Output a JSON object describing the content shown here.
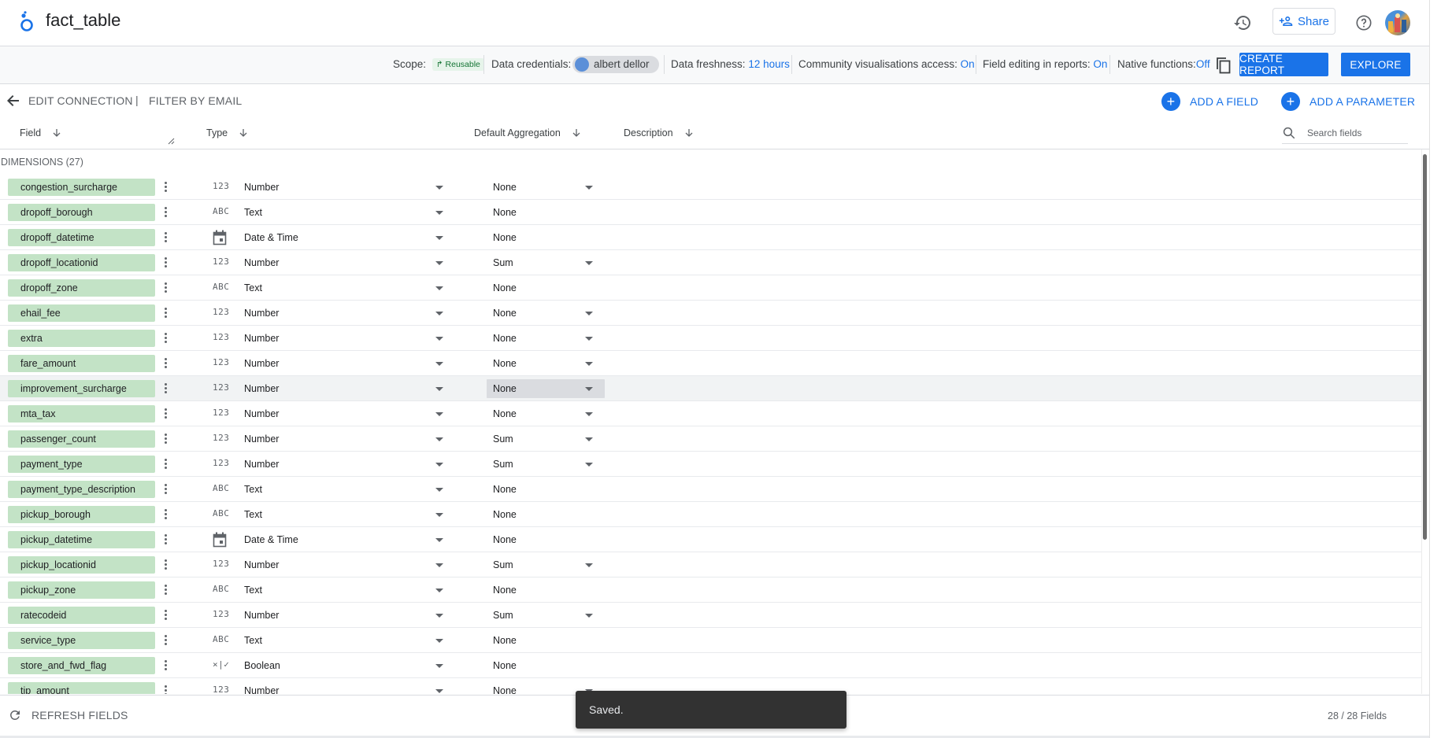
{
  "app": {
    "title": "fact_table",
    "share_label": "Share"
  },
  "icons": {
    "logo": "looker-studio-logo",
    "history": "history-icon",
    "share": "person-add-icon",
    "help": "help-icon",
    "copy": "copy-icon",
    "back": "back-arrow-icon",
    "add": "plus-icon",
    "search": "search-icon",
    "refresh": "refresh-icon",
    "more": "more-vert-icon"
  },
  "colors": {
    "accent": "#1a73e8",
    "dimension_chip": "#c3e3c6",
    "reusable_chip_bg": "#e6f4ea",
    "reusable_chip_text": "#137333"
  },
  "meta": {
    "scope_label": "Scope:",
    "scope_value": "Reusable",
    "credentials_label": "Data credentials:",
    "credentials_user": "albert dellor",
    "freshness_label": "Data freshness:",
    "freshness_value": "12 hours",
    "community_label": "Community visualisations access:",
    "community_value": "On",
    "field_editing_label": "Field editing in reports:",
    "field_editing_value": "On",
    "native_label": "Native functions:",
    "native_value": "Off",
    "create_report": "CREATE REPORT",
    "explore": "EXPLORE"
  },
  "subbar": {
    "edit_connection": "EDIT CONNECTION",
    "separator": "|",
    "title": "FILTER BY EMAIL",
    "add_field": "ADD A FIELD",
    "add_parameter": "ADD A PARAMETER"
  },
  "columns": {
    "field": "Field",
    "type": "Type",
    "aggregation": "Default Aggregation",
    "description": "Description",
    "search_placeholder": "Search fields"
  },
  "section": {
    "title": "DIMENSIONS (27)"
  },
  "fields": [
    {
      "name": "congestion_surcharge",
      "type_icon": "123",
      "type": "Number",
      "aggregation": "None",
      "agg_dropdown": true
    },
    {
      "name": "dropoff_borough",
      "type_icon": "ABC",
      "type": "Text",
      "aggregation": "None",
      "agg_dropdown": false
    },
    {
      "name": "dropoff_datetime",
      "type_icon": "calendar",
      "type": "Date & Time",
      "aggregation": "None",
      "agg_dropdown": false
    },
    {
      "name": "dropoff_locationid",
      "type_icon": "123",
      "type": "Number",
      "aggregation": "Sum",
      "agg_dropdown": true
    },
    {
      "name": "dropoff_zone",
      "type_icon": "ABC",
      "type": "Text",
      "aggregation": "None",
      "agg_dropdown": false
    },
    {
      "name": "ehail_fee",
      "type_icon": "123",
      "type": "Number",
      "aggregation": "None",
      "agg_dropdown": true
    },
    {
      "name": "extra",
      "type_icon": "123",
      "type": "Number",
      "aggregation": "None",
      "agg_dropdown": true
    },
    {
      "name": "fare_amount",
      "type_icon": "123",
      "type": "Number",
      "aggregation": "None",
      "agg_dropdown": true
    },
    {
      "name": "improvement_surcharge",
      "type_icon": "123",
      "type": "Number",
      "aggregation": "None",
      "agg_dropdown": true,
      "highlight": true
    },
    {
      "name": "mta_tax",
      "type_icon": "123",
      "type": "Number",
      "aggregation": "None",
      "agg_dropdown": true
    },
    {
      "name": "passenger_count",
      "type_icon": "123",
      "type": "Number",
      "aggregation": "Sum",
      "agg_dropdown": true
    },
    {
      "name": "payment_type",
      "type_icon": "123",
      "type": "Number",
      "aggregation": "Sum",
      "agg_dropdown": true
    },
    {
      "name": "payment_type_description",
      "type_icon": "ABC",
      "type": "Text",
      "aggregation": "None",
      "agg_dropdown": false
    },
    {
      "name": "pickup_borough",
      "type_icon": "ABC",
      "type": "Text",
      "aggregation": "None",
      "agg_dropdown": false
    },
    {
      "name": "pickup_datetime",
      "type_icon": "calendar",
      "type": "Date & Time",
      "aggregation": "None",
      "agg_dropdown": false
    },
    {
      "name": "pickup_locationid",
      "type_icon": "123",
      "type": "Number",
      "aggregation": "Sum",
      "agg_dropdown": true
    },
    {
      "name": "pickup_zone",
      "type_icon": "ABC",
      "type": "Text",
      "aggregation": "None",
      "agg_dropdown": false
    },
    {
      "name": "ratecodeid",
      "type_icon": "123",
      "type": "Number",
      "aggregation": "Sum",
      "agg_dropdown": true
    },
    {
      "name": "service_type",
      "type_icon": "ABC",
      "type": "Text",
      "aggregation": "None",
      "agg_dropdown": false
    },
    {
      "name": "store_and_fwd_flag",
      "type_icon": "×|✓",
      "type": "Boolean",
      "aggregation": "None",
      "agg_dropdown": false
    },
    {
      "name": "tip_amount",
      "type_icon": "123",
      "type": "Number",
      "aggregation": "None",
      "agg_dropdown": true
    }
  ],
  "footer": {
    "refresh": "REFRESH FIELDS",
    "count": "28 / 28 Fields"
  },
  "snackbar": {
    "message": "Saved."
  }
}
